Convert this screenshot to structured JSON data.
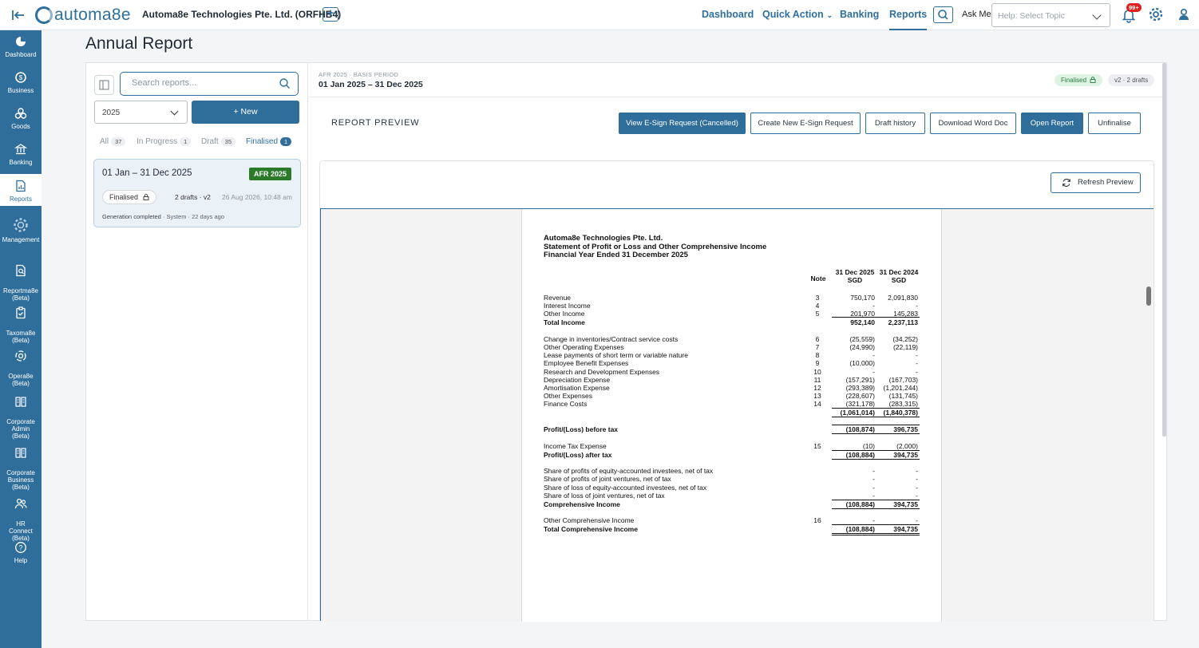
{
  "topbar": {
    "logo_text": "automa8e",
    "company": "Automa8e Technologies Pte. Ltd. (ORFHB4)",
    "add_company": "+",
    "nav": [
      {
        "label": "Dashboard"
      },
      {
        "label": "Quick Action"
      },
      {
        "label": "Banking"
      },
      {
        "label": "Reports"
      }
    ],
    "ask_me": "Ask Me",
    "topic_placeholder": "Help: Select Topic",
    "notif_badge": "99+"
  },
  "sidebar": {
    "items": [
      {
        "label": "Dashboard",
        "icon": "dashboard-icon"
      },
      {
        "label": "Business",
        "icon": "business-icon"
      },
      {
        "label": "Goods",
        "icon": "goods-icon"
      },
      {
        "label": "Banking",
        "icon": "bank-icon"
      },
      {
        "label": "Reports",
        "icon": "reports-icon"
      },
      {
        "label": "Management",
        "icon": "management-icon"
      },
      {
        "label": "Reportma8e\n(Beta)",
        "icon": "reportma8e-icon"
      },
      {
        "label": "Taxoma8e\n(Beta)",
        "icon": "taxoma8e-icon"
      },
      {
        "label": "Opera8e\n(Beta)",
        "icon": "opera8e-icon"
      },
      {
        "label": "Corporate\nAdmin\n(Beta)",
        "icon": "corporate-admin-icon"
      },
      {
        "label": "Corporate\nBusiness\n(Beta)",
        "icon": "corporate-business-icon"
      },
      {
        "label": "HR\nConnect\n(Beta)",
        "icon": "hr-connect-icon"
      },
      {
        "label": "Help",
        "icon": "help-icon"
      }
    ]
  },
  "page": {
    "title": "Annual Report"
  },
  "left_panel": {
    "search_placeholder": "Search reports...",
    "year": "2025",
    "new_label": "+ New",
    "filters": [
      {
        "label": "All",
        "count": "37"
      },
      {
        "label": "In Progress",
        "count": "1"
      },
      {
        "label": "Draft",
        "count": "35"
      },
      {
        "label": "Finalised",
        "count": "1"
      }
    ],
    "report": {
      "title": "01 Jan – 31 Dec 2025",
      "tag": "AFR 2025",
      "status": "Finalised",
      "drafts": "2 drafts · v2",
      "date": "26 Aug 2026, 10:48 am",
      "gen_status": "Generation completed",
      "gen_meta": " · System · 22 days ago"
    }
  },
  "right_panel": {
    "period_label": "AFR 2025 · BASIS PERIOD",
    "period_value": "01 Jan 2025 – 31 Dec 2025",
    "status_pill": "Finalised",
    "version_pill": "v2 · 2 drafts",
    "preview_title": "REPORT PREVIEW",
    "actions": [
      {
        "label": "View E-Sign Request (Cancelled)"
      },
      {
        "label": "Create New E-Sign Request"
      },
      {
        "label": "Draft history"
      },
      {
        "label": "Download Word Doc"
      },
      {
        "label": "Open Report"
      },
      {
        "label": "Unfinalise"
      }
    ],
    "refresh_label": "Refresh Preview"
  },
  "document": {
    "company": "Automa8e Technologies Pte. Ltd.",
    "statement": "Statement of Profit or Loss and Other Comprehensive Income",
    "period": "Financial Year Ended 31 December 2025",
    "col_note": "Note",
    "col_2025": "31 Dec 2025",
    "col_2024": "31 Dec 2024",
    "currency": "SGD",
    "lines": [
      {
        "label": "Revenue",
        "note": "3",
        "v2025": "750,170",
        "v2024": "2,091,830",
        "bold": false
      },
      {
        "label": "Interest Income",
        "note": "4",
        "v2025": "-",
        "v2024": "-",
        "bold": false
      },
      {
        "label": "Other Income",
        "note": "5",
        "v2025": "201,970",
        "v2024": "145,283",
        "bold": false
      },
      {
        "label": "Total Income",
        "note": "",
        "v2025": "952,140",
        "v2024": "2,237,113",
        "bold": true
      },
      {
        "label": "Change in inventories/Contract service costs",
        "note": "6",
        "v2025": "(25,559)",
        "v2024": "(34,252)",
        "bold": false
      },
      {
        "label": "Other Operating Expenses",
        "note": "7",
        "v2025": "(24,990)",
        "v2024": "(22,119)",
        "bold": false
      },
      {
        "label": "Lease payments of short term or variable nature",
        "note": "8",
        "v2025": "-",
        "v2024": "-",
        "bold": false
      },
      {
        "label": "Employee Benefit Expenses",
        "note": "9",
        "v2025": "(10,000)",
        "v2024": "-",
        "bold": false
      },
      {
        "label": "Research and Development Expenses",
        "note": "10",
        "v2025": "-",
        "v2024": "-",
        "bold": false
      },
      {
        "label": "Depreciation Expense",
        "note": "11",
        "v2025": "(157,291)",
        "v2024": "(167,703)",
        "bold": false
      },
      {
        "label": "Amortisation Expense",
        "note": "12",
        "v2025": "(293,389)",
        "v2024": "(1,201,244)",
        "bold": false
      },
      {
        "label": "Other Expenses",
        "note": "13",
        "v2025": "(228,607)",
        "v2024": "(131,745)",
        "bold": false
      },
      {
        "label": "Finance Costs",
        "note": "14",
        "v2025": "(321,178)",
        "v2024": "(283,315)",
        "bold": false
      },
      {
        "label": "",
        "note": "",
        "v2025": "(1,061,014)",
        "v2024": "(1,840,378)",
        "bold": true
      },
      {
        "label": "Profit/(Loss) before tax",
        "note": "",
        "v2025": "(108,874)",
        "v2024": "396,735",
        "bold": true
      },
      {
        "label": "Income Tax Expense",
        "note": "15",
        "v2025": "(10)",
        "v2024": "(2,000)",
        "bold": false
      },
      {
        "label": "Profit/(Loss) after tax",
        "note": "",
        "v2025": "(108,884)",
        "v2024": "394,735",
        "bold": true
      },
      {
        "label": "Share of profits of equity-accounted investees, net of tax",
        "note": "",
        "v2025": "-",
        "v2024": "-",
        "bold": false
      },
      {
        "label": "Share of profits of joint ventures, net of tax",
        "note": "",
        "v2025": "-",
        "v2024": "-",
        "bold": false
      },
      {
        "label": "Share of loss of equity-accounted investees, net of tax",
        "note": "",
        "v2025": "-",
        "v2024": "-",
        "bold": false
      },
      {
        "label": "Share of loss of joint ventures, net of tax",
        "note": "",
        "v2025": "-",
        "v2024": "-",
        "bold": false
      },
      {
        "label": "Comprehensive Income",
        "note": "",
        "v2025": "(108,884)",
        "v2024": "394,735",
        "bold": true
      },
      {
        "label": "Other Comprehensive Income",
        "note": "16",
        "v2025": "-",
        "v2024": "-",
        "bold": false
      },
      {
        "label": "Total Comprehensive Income",
        "note": "",
        "v2025": "(108,884)",
        "v2024": "394,735",
        "bold": true
      }
    ]
  }
}
